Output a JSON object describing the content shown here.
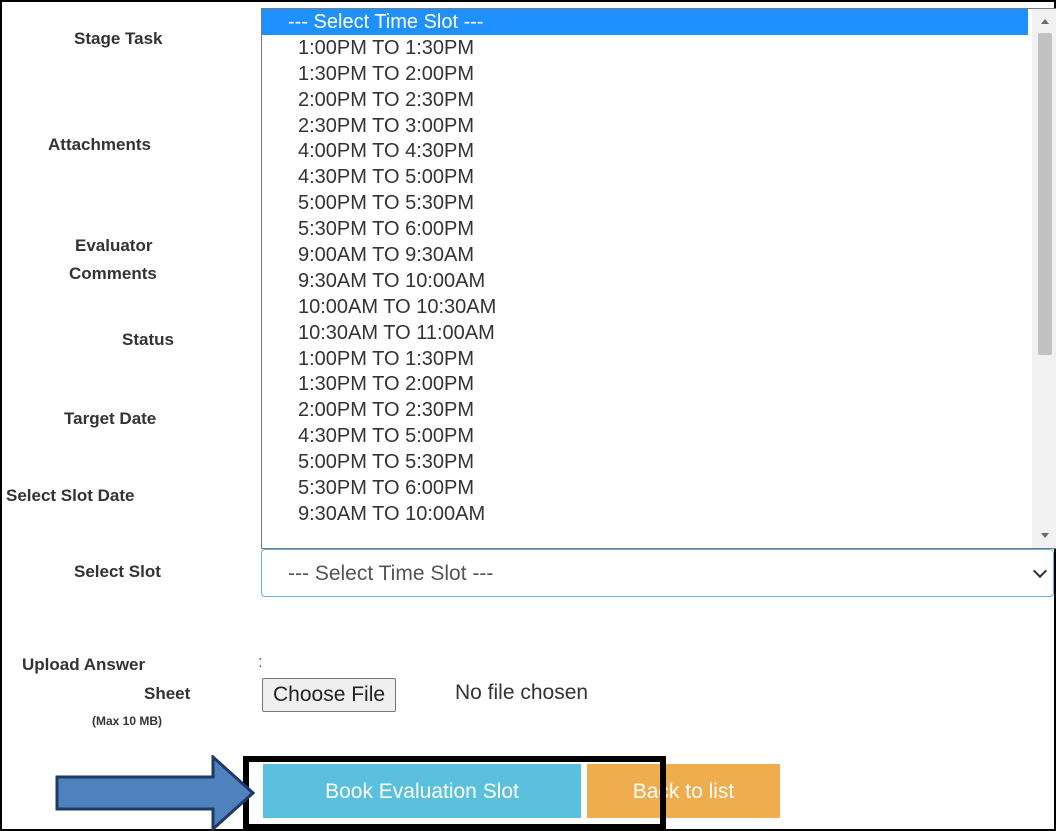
{
  "form": {
    "labels": {
      "stage_task": "Stage Task",
      "attachments": "Attachments",
      "evaluator": "Evaluator",
      "comments": "Comments",
      "status": "Status",
      "target_date": "Target Date",
      "select_slot_date": "Select Slot Date",
      "select_slot": "Select Slot",
      "upload_answer": "Upload Answer",
      "sheet": "Sheet",
      "max_size": "(Max 10 MB)"
    },
    "colon": ":"
  },
  "slot_dropdown": {
    "selected_value": "--- Select Time Slot ---",
    "options": [
      "--- Select Time Slot ---",
      "1:00PM TO 1:30PM",
      "1:30PM TO 2:00PM",
      "2:00PM TO 2:30PM",
      "2:30PM TO 3:00PM",
      "4:00PM TO 4:30PM",
      "4:30PM TO 5:00PM",
      "5:00PM TO 5:30PM",
      "5:30PM TO 6:00PM",
      "9:00AM TO 9:30AM",
      "9:30AM TO 10:00AM",
      "10:00AM TO 10:30AM",
      "10:30AM TO 11:00AM",
      "1:00PM TO 1:30PM",
      "1:30PM TO 2:00PM",
      "2:00PM TO 2:30PM",
      "4:30PM TO 5:00PM",
      "5:00PM TO 5:30PM",
      "5:30PM TO 6:00PM",
      "9:30AM TO 10:00AM"
    ]
  },
  "upload": {
    "choose_file_label": "Choose File",
    "no_file_text": "No file chosen"
  },
  "actions": {
    "book_label": "Book Evaluation Slot",
    "back_label": "Back to list"
  },
  "colors": {
    "highlight": "#1e90ff",
    "book_button": "#5bc0de",
    "back_button": "#f0ad4e",
    "arrow_fill": "#4f81bd"
  }
}
